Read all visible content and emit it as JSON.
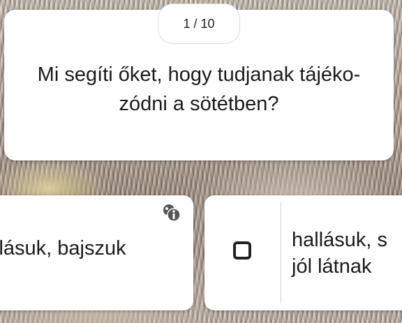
{
  "quiz": {
    "counter": "1 / 10",
    "question_line1": "Mi segíti őket, hogy tudjanak tájéko-",
    "question_line2": "zódni a sötétben?"
  },
  "answers": [
    {
      "text": "llásuk, bajszuk",
      "has_info_icon": true
    },
    {
      "text_line1": "hallásuk, s",
      "text_line2": "jól látnak",
      "checkbox_checked": false
    }
  ],
  "icons": {
    "info": "info-icon",
    "checkbox": "checkbox-icon"
  }
}
